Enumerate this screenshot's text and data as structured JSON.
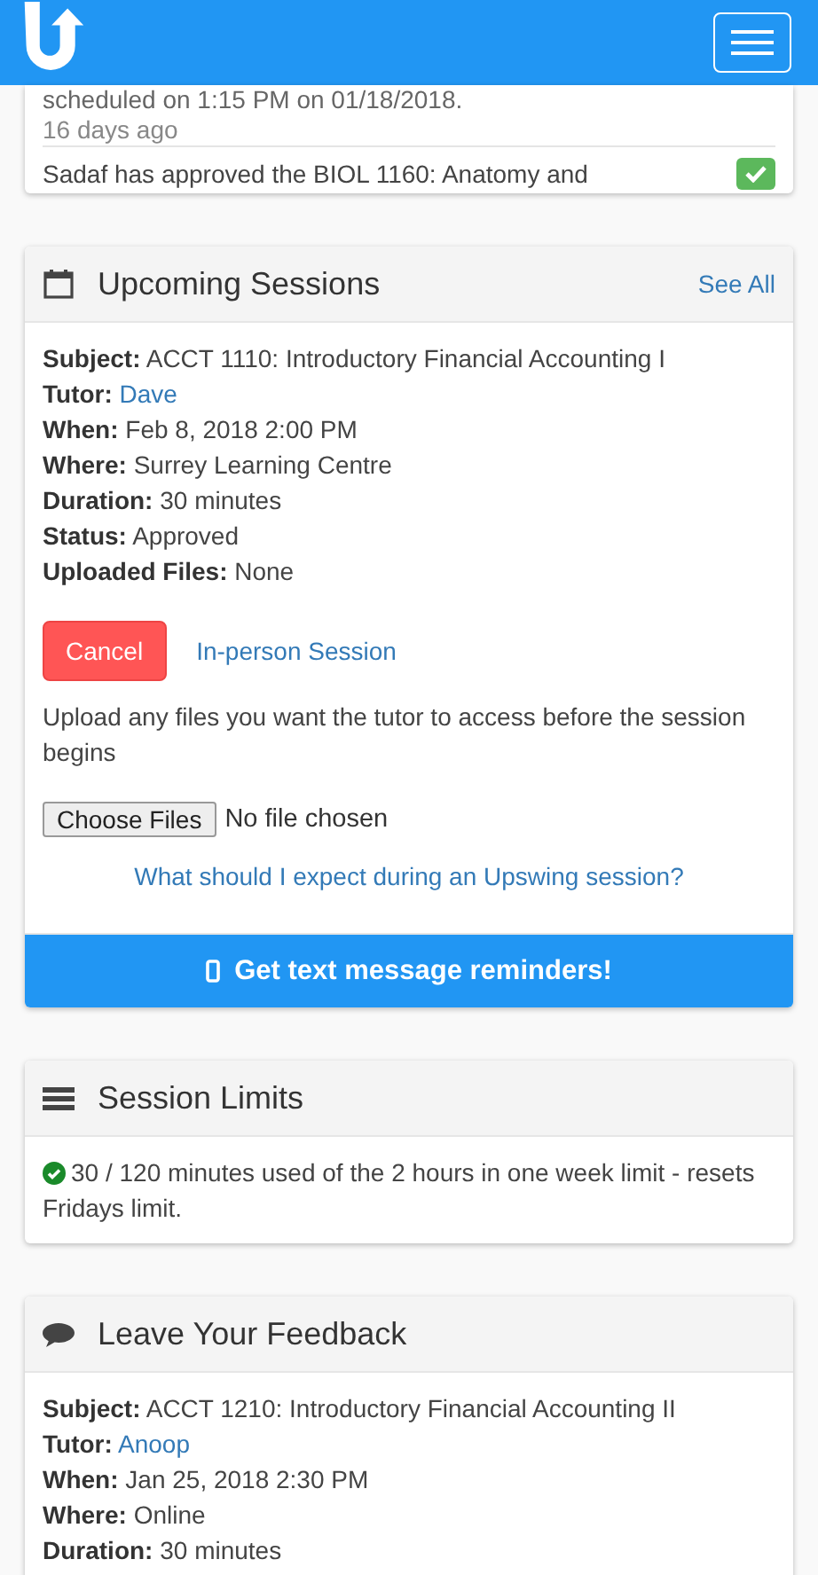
{
  "notifications": [
    {
      "text": "scheduled on 1:15 PM on 01/18/2018.",
      "time": "16 days ago"
    },
    {
      "text": "Sadaf has approved the BIOL 1160: Anatomy and",
      "approved": true
    }
  ],
  "upcoming": {
    "title": "Upcoming Sessions",
    "see_all": "See All",
    "fields": [
      {
        "label": "Subject:",
        "value": "ACCT 1110: Introductory Financial Accounting I",
        "kind": "text"
      },
      {
        "label": "Tutor:",
        "value": "Dave",
        "kind": "link"
      },
      {
        "label": "When:",
        "value": "Feb 8, 2018 2:00 PM",
        "kind": "text"
      },
      {
        "label": "Where:",
        "value": "Surrey Learning Centre",
        "kind": "text"
      },
      {
        "label": "Duration:",
        "value": "30 minutes",
        "kind": "text"
      },
      {
        "label": "Status:",
        "value": "Approved",
        "kind": "text"
      },
      {
        "label": "Uploaded Files:",
        "value": "None",
        "kind": "text"
      }
    ],
    "cancel": "Cancel",
    "session_type": "In-person Session",
    "upload_hint": "Upload any files you want the tutor to access before the session begins",
    "file_button": "Choose Files",
    "file_status": "No file chosen",
    "faq_link": "What should I expect during an Upswing session?",
    "reminder_button": "Get text message reminders!"
  },
  "limits": {
    "title": "Session Limits",
    "message": "30 / 120 minutes used of the 2 hours in one week limit - resets Fridays limit."
  },
  "feedback": {
    "title": "Leave Your Feedback",
    "fields": [
      {
        "label": "Subject:",
        "value": "ACCT 1210: Introductory Financial Accounting II",
        "kind": "text"
      },
      {
        "label": "Tutor:",
        "value": "Anoop",
        "kind": "link"
      },
      {
        "label": "When:",
        "value": "Jan 25, 2018 2:30 PM",
        "kind": "text"
      },
      {
        "label": "Where:",
        "value": "Online",
        "kind": "text"
      },
      {
        "label": "Duration:",
        "value": "30 minutes",
        "kind": "text"
      }
    ]
  }
}
